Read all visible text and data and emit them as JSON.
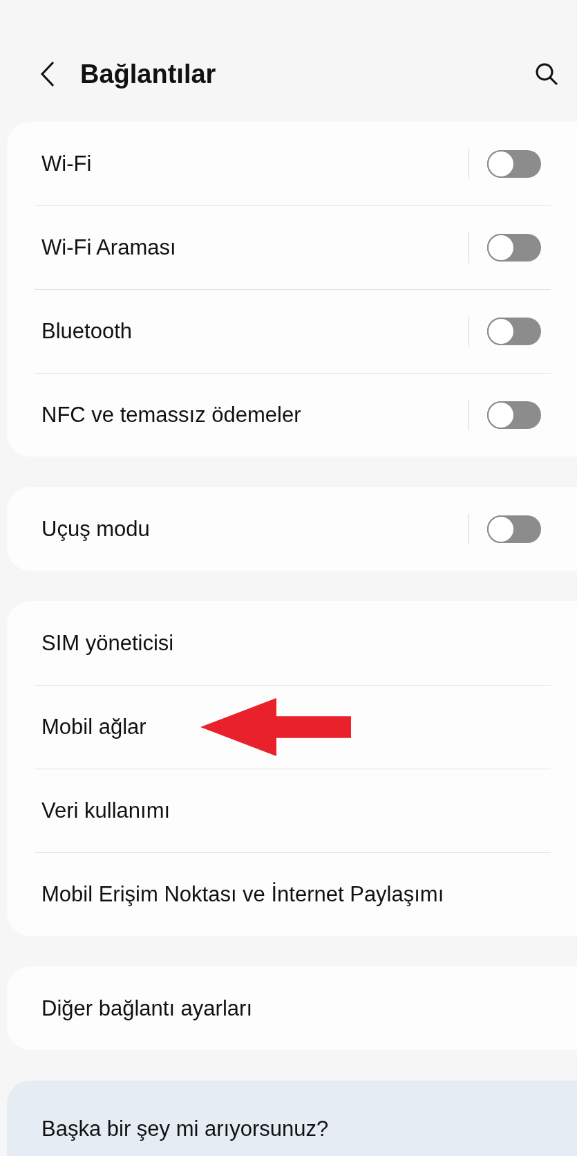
{
  "header": {
    "title": "Bağlantılar"
  },
  "groups": [
    {
      "rows": [
        {
          "label": "Wi-Fi",
          "kind": "toggle",
          "on": false
        },
        {
          "label": "Wi-Fi Araması",
          "kind": "toggle",
          "on": false
        },
        {
          "label": "Bluetooth",
          "kind": "toggle",
          "on": false
        },
        {
          "label": "NFC ve temassız ödemeler",
          "kind": "toggle",
          "on": false
        }
      ]
    },
    {
      "rows": [
        {
          "label": "Uçuş modu",
          "kind": "toggle",
          "on": false
        }
      ]
    },
    {
      "rows": [
        {
          "label": "SIM yöneticisi",
          "kind": "link"
        },
        {
          "label": "Mobil ağlar",
          "kind": "link"
        },
        {
          "label": "Veri kullanımı",
          "kind": "link"
        },
        {
          "label": "Mobil Erişim Noktası ve İnternet Paylaşımı",
          "kind": "link"
        }
      ]
    },
    {
      "rows": [
        {
          "label": "Diğer bağlantı ayarları",
          "kind": "link"
        }
      ]
    }
  ],
  "suggestion": {
    "title": "Başka bir şey mi arıyorsunuz?"
  }
}
